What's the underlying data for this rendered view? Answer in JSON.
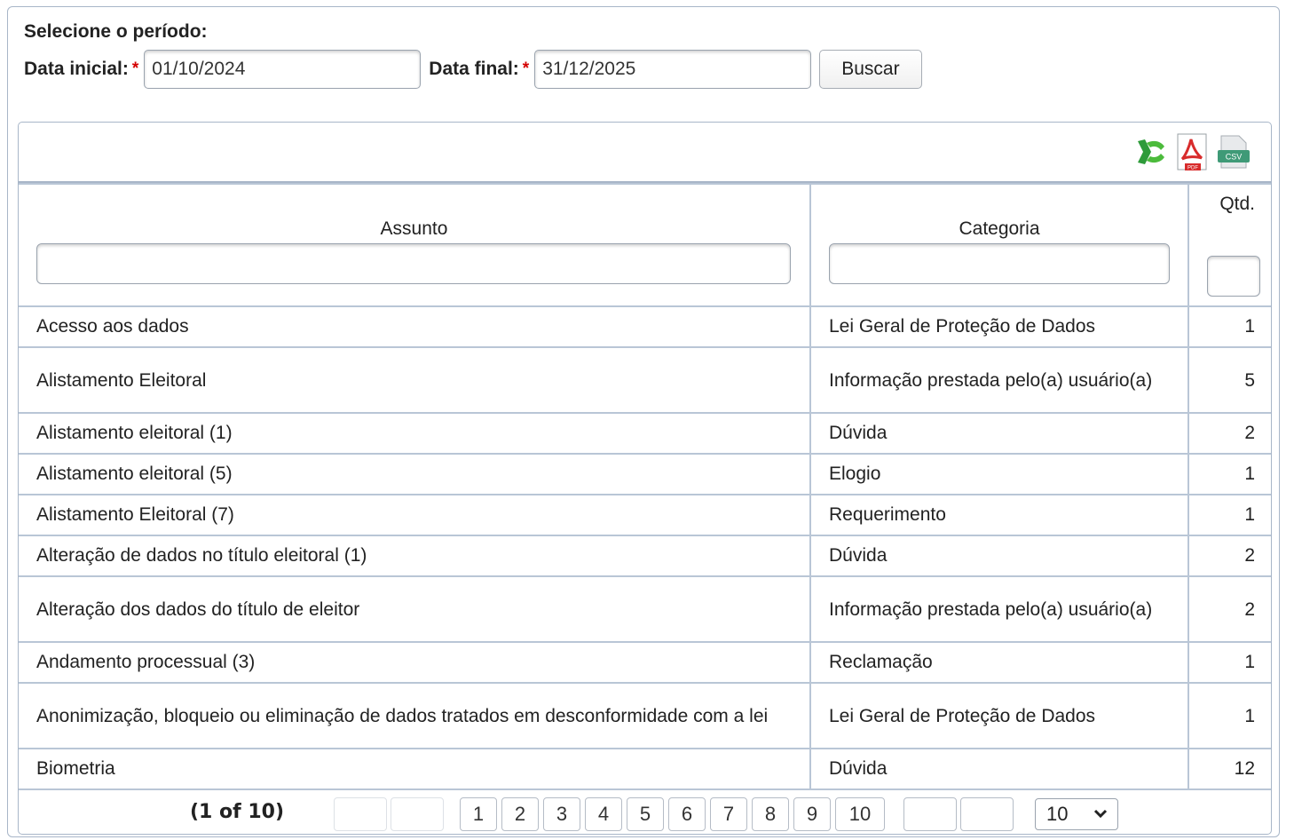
{
  "period": {
    "title": "Selecione o período:",
    "start_label": "Data inicial:",
    "start_value": "01/10/2024",
    "end_label": "Data final:",
    "end_value": "31/12/2025",
    "required_mark": "*",
    "search_label": "Buscar"
  },
  "export": {
    "icons": [
      "excel-icon",
      "pdf-icon",
      "csv-icon"
    ],
    "pdf_text": "PDF",
    "csv_text": "CSV"
  },
  "table": {
    "headers": {
      "subject": "Assunto",
      "category": "Categoria",
      "qty": "Qtd."
    },
    "rows": [
      {
        "subject": "Acesso aos dados",
        "category": "Lei Geral de Proteção de Dados",
        "qty": "1"
      },
      {
        "subject": "Alistamento Eleitoral",
        "category": "Informação prestada pelo(a) usuário(a)",
        "qty": "5"
      },
      {
        "subject": "Alistamento eleitoral (1)",
        "category": "Dúvida",
        "qty": "2"
      },
      {
        "subject": "Alistamento eleitoral (5)",
        "category": "Elogio",
        "qty": "1"
      },
      {
        "subject": "Alistamento Eleitoral (7)",
        "category": "Requerimento",
        "qty": "1"
      },
      {
        "subject": "Alteração de dados no título eleitoral (1)",
        "category": "Dúvida",
        "qty": "2"
      },
      {
        "subject": "Alteração dos dados do título de eleitor",
        "category": "Informação prestada pelo(a) usuário(a)",
        "qty": "2"
      },
      {
        "subject": "Andamento processual (3)",
        "category": "Reclamação",
        "qty": "1"
      },
      {
        "subject": "Anonimização, bloqueio ou eliminação de dados tratados em desconformidade com a lei",
        "category": "Lei Geral de Proteção de Dados",
        "qty": "1"
      },
      {
        "subject": "Biometria",
        "category": "Dúvida",
        "qty": "12"
      }
    ]
  },
  "paginator": {
    "current": "(1 of 10)",
    "pages": [
      "1",
      "2",
      "3",
      "4",
      "5",
      "6",
      "7",
      "8",
      "9",
      "10"
    ],
    "rows_per_page": "10"
  },
  "colors": {
    "border": "#a8b6c8",
    "required": "#d40000",
    "excel_green": "#2e9b3a",
    "pdf_red": "#d82b2b"
  }
}
